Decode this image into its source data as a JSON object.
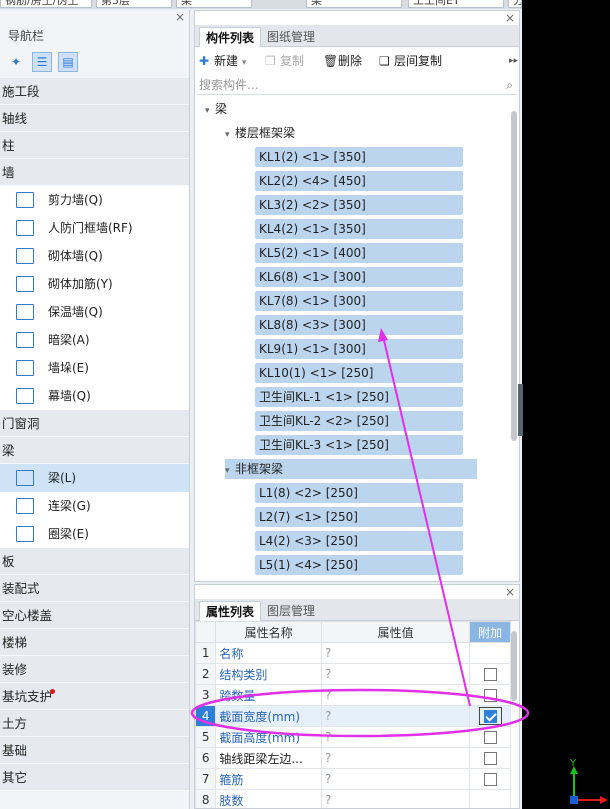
{
  "top_selectors": [
    "钢筋/房土/伪土",
    "第3层",
    "梁",
    "梁",
    "工工间ET",
    "分层1"
  ],
  "left_nav": {
    "title": "导航栏",
    "categories_before": [
      "施工段",
      "轴线",
      "柱",
      "墙"
    ],
    "wall_items": [
      "剪力墙(Q)",
      "人防门框墙(RF)",
      "砌体墙(Q)",
      "砌体加筋(Y)",
      "保温墙(Q)",
      "暗梁(A)",
      "墙垛(E)",
      "幕墙(Q)"
    ],
    "categories_mid": [
      "门窗洞",
      "梁"
    ],
    "beam_items": [
      "梁(L)",
      "连梁(G)",
      "圈梁(E)"
    ],
    "categories_after": [
      "板",
      "装配式",
      "空心楼盖",
      "楼梯",
      "装修",
      "基坑支护",
      "土方",
      "基础",
      "其它"
    ]
  },
  "component_panel": {
    "tabs": [
      "构件列表",
      "图纸管理"
    ],
    "toolbar": {
      "new": "新建",
      "copy": "复制",
      "delete": "删除",
      "floor_copy": "层间复制"
    },
    "search_placeholder": "搜索构件...",
    "tree": {
      "root": "梁",
      "group1": "楼层框架梁",
      "group1_items": [
        "KL1(2) <1> [350]",
        "KL2(2) <4> [450]",
        "KL3(2) <2> [350]",
        "KL4(2) <1> [350]",
        "KL5(2) <1> [400]",
        "KL6(8) <1> [300]",
        "KL7(8) <1> [300]",
        "KL8(8) <3> [300]",
        "KL9(1) <1> [300]",
        "KL10(1) <1> [250]",
        "卫生间KL-1 <1> [250]",
        "卫生间KL-2 <2> [250]",
        "卫生间KL-3 <1> [250]"
      ],
      "group2": "非框架梁",
      "group2_items": [
        "L1(8) <2> [250]",
        "L2(7) <1> [250]",
        "L4(2) <3> [250]",
        "L5(1) <4> [250]"
      ]
    }
  },
  "property_panel": {
    "tabs": [
      "属性列表",
      "图层管理"
    ],
    "headers": [
      "属性名称",
      "属性值",
      "附加"
    ],
    "rows": [
      {
        "num": "1",
        "name": "名称",
        "value": "?",
        "add": null
      },
      {
        "num": "2",
        "name": "结构类别",
        "value": "?",
        "add": false
      },
      {
        "num": "3",
        "name": "跨数量",
        "value": "?",
        "add": false
      },
      {
        "num": "4",
        "name": "截面宽度(mm)",
        "value": "?",
        "add": true
      },
      {
        "num": "5",
        "name": "截面高度(mm)",
        "value": "?",
        "add": false
      },
      {
        "num": "6",
        "name": "轴线距梁左边...",
        "value": "?",
        "add": false
      },
      {
        "num": "7",
        "name": "箍筋",
        "value": "?",
        "add": false
      },
      {
        "num": "8",
        "name": "肢数",
        "value": "?",
        "add": null
      }
    ]
  },
  "axis": {
    "y_label": "Y",
    "color_y": "#19c219",
    "color_x": "#e01919",
    "color_z": "#1a5bd6"
  },
  "colors": {
    "annotation": "#e030e8",
    "selection": "#bcd5ee",
    "accent": "#2e7fd8"
  }
}
